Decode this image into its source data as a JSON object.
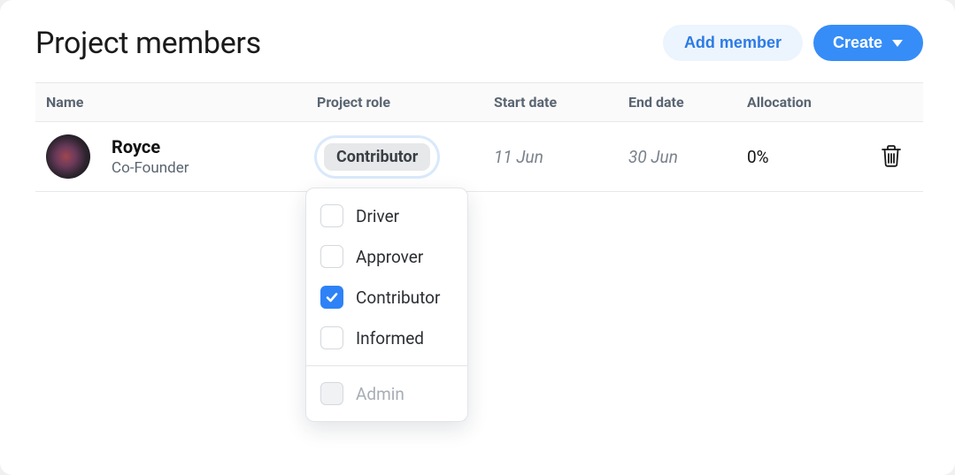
{
  "header": {
    "title": "Project members",
    "add_member_label": "Add member",
    "create_label": "Create"
  },
  "columns": {
    "name": "Name",
    "role": "Project role",
    "start": "Start date",
    "end": "End date",
    "allocation": "Allocation"
  },
  "members": [
    {
      "name": "Royce",
      "title": "Co-Founder",
      "role_label": "Contributor",
      "start_date": "11 Jun",
      "end_date": "30 Jun",
      "allocation": "0%"
    }
  ],
  "role_dropdown": {
    "options": [
      {
        "label": "Driver",
        "checked": false,
        "disabled": false
      },
      {
        "label": "Approver",
        "checked": false,
        "disabled": false
      },
      {
        "label": "Contributor",
        "checked": true,
        "disabled": false
      },
      {
        "label": "Informed",
        "checked": false,
        "disabled": false
      }
    ],
    "admin_option": {
      "label": "Admin",
      "checked": false,
      "disabled": true
    }
  }
}
